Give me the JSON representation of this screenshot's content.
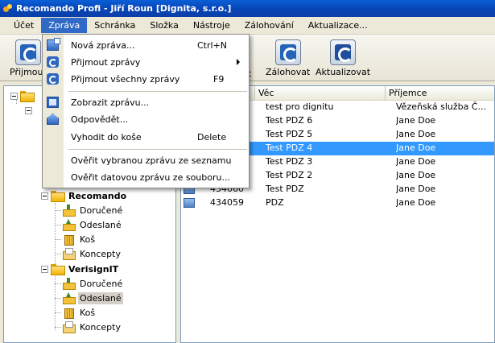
{
  "window": {
    "title": "Recomando Profi - Jiří Roun [Dignita, s.r.o.]"
  },
  "menubar": {
    "items": [
      "Účet",
      "Zpráva",
      "Schránka",
      "Složka",
      "Nástroje",
      "Zálohování",
      "Aktualizace..."
    ]
  },
  "toolbar": {
    "receive_label": "Přijmout",
    "receive_label_tail": "t",
    "backup_label": "Zálohovat",
    "update_label": "Aktualizovat"
  },
  "tree": {
    "accounts": [
      {
        "name": "Recomando",
        "folders": [
          "Doručené",
          "Odeslané",
          "Koš",
          "Koncepty"
        ]
      },
      {
        "name": "VerisignIT",
        "folders": [
          "Doručené",
          "Odeslané",
          "Koš",
          "Koncepty"
        ],
        "selected_folder": "Odeslané"
      }
    ]
  },
  "list": {
    "columns": [
      "Věc",
      "Příjemce"
    ],
    "rows": [
      {
        "id": "",
        "subject": "test pro dignitu",
        "recipient": "Vězeňská služba Č..."
      },
      {
        "id": "",
        "subject": "Test PDZ 6",
        "recipient": "Jane Doe"
      },
      {
        "id": "",
        "subject": "Test PDZ 5",
        "recipient": "Jane Doe"
      },
      {
        "id": "",
        "subject": "Test PDZ 4",
        "recipient": "Jane Doe",
        "selected": true
      },
      {
        "id": "",
        "subject": "Test PDZ 3",
        "recipient": "Jane Doe"
      },
      {
        "id": "",
        "subject": "Test PDZ 2",
        "recipient": "Jane Doe"
      },
      {
        "id": "434060",
        "subject": "Test PDZ",
        "recipient": "Jane Doe"
      },
      {
        "id": "434059",
        "subject": "PDZ",
        "recipient": "Jane Doe"
      }
    ]
  },
  "dropdown": {
    "items": [
      {
        "label": "Nová zpráva...",
        "shortcut": "Ctrl+N",
        "icon": "new-message-icon"
      },
      {
        "label": "Přijmout zprávy",
        "submenu": true,
        "icon": "receive-icon"
      },
      {
        "label": "Přijmout všechny zprávy",
        "shortcut": "F9",
        "icon": "receive-all-icon"
      },
      {
        "label": "Zobrazit zprávu...",
        "icon": "show-message-icon"
      },
      {
        "label": "Odpovědět...",
        "icon": "reply-icon"
      },
      {
        "label": "Vyhodit do koše",
        "shortcut": "Delete"
      },
      {
        "label": "Ověřit vybranou zprávu ze seznamu"
      },
      {
        "label": "Ověřit datovou zprávu ze souboru..."
      }
    ]
  },
  "colors": {
    "selection": "#3399ff",
    "menu_highlight": "#3169c6",
    "titlebar": "#0a5fd6"
  }
}
